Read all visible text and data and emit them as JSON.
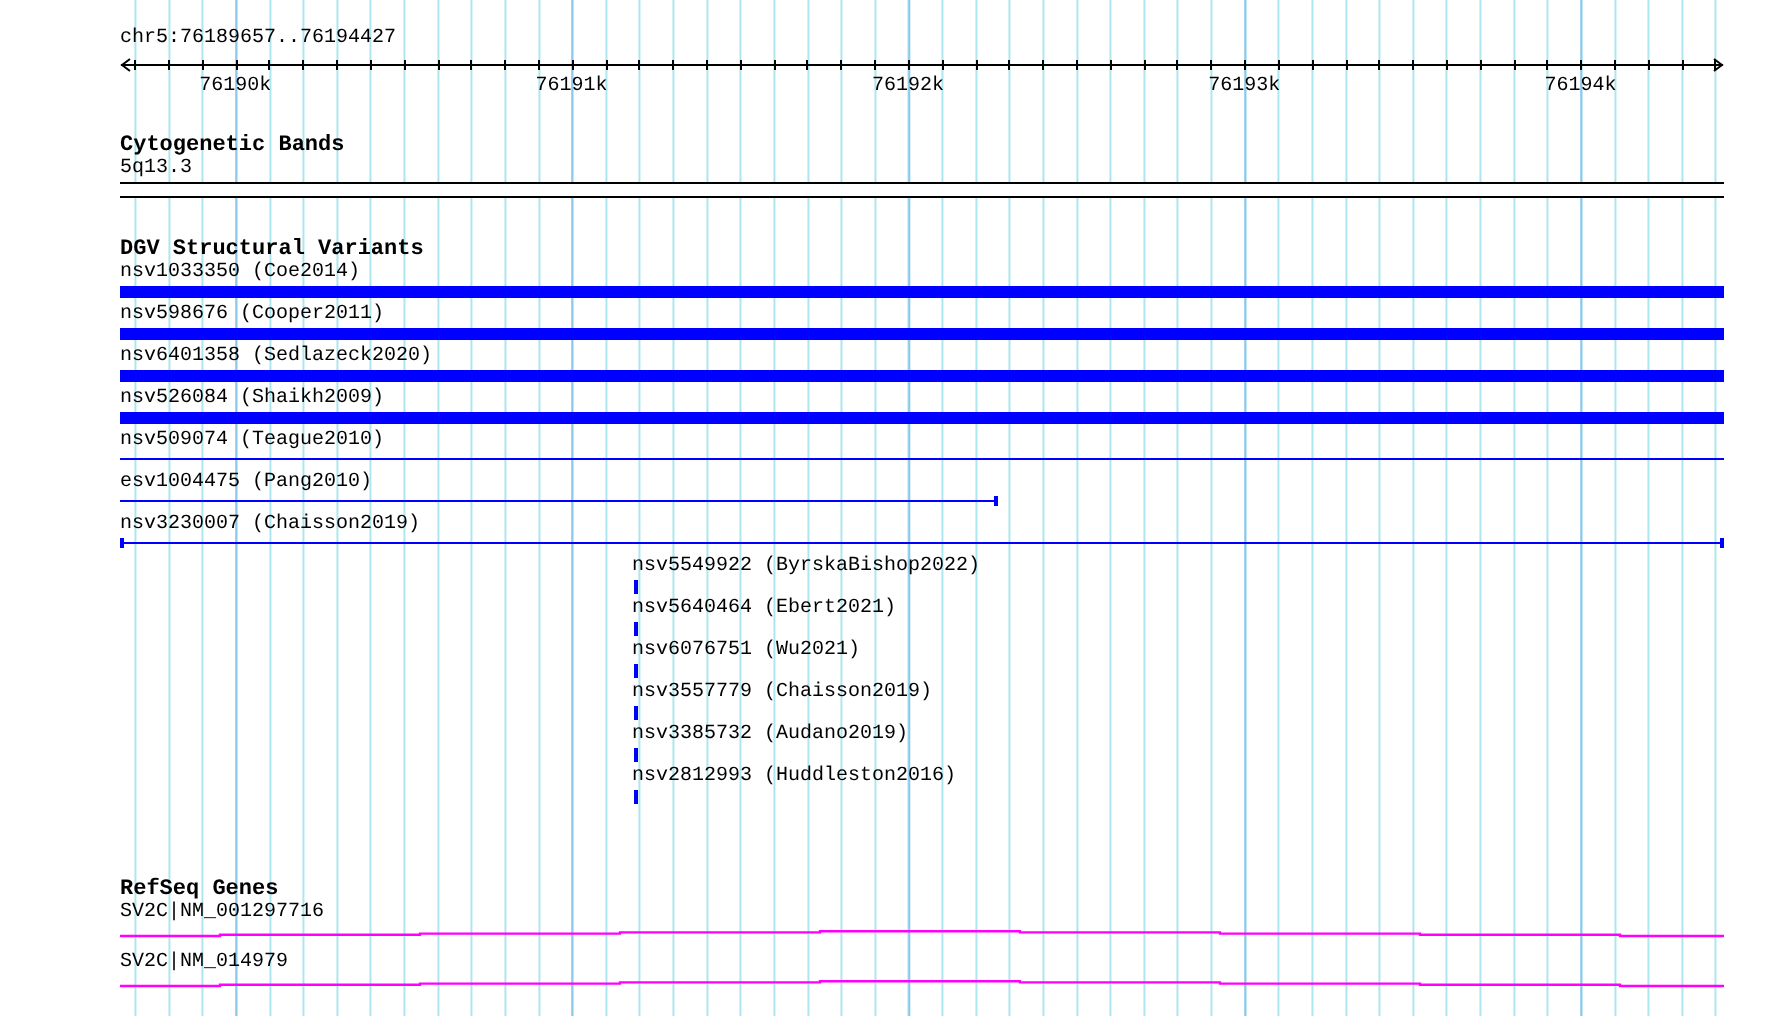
{
  "locus": "chr5:76189657..76194427",
  "axis": {
    "tick_labels": [
      "76190k",
      "76191k",
      "76192k",
      "76193k",
      "76194k"
    ]
  },
  "tracks": [
    {
      "kind": "bands",
      "title": "Cytogenetic Bands",
      "features": [
        {
          "label": "5q13.3"
        }
      ]
    },
    {
      "kind": "variants",
      "title": "DGV Structural Variants",
      "features": [
        {
          "label": "nsv1033350 (Coe2014)",
          "kind": "thick"
        },
        {
          "label": "nsv598676 (Cooper2011)",
          "kind": "thick"
        },
        {
          "label": "nsv6401358 (Sedlazeck2020)",
          "kind": "thick"
        },
        {
          "label": "nsv526084 (Shaikh2009)",
          "kind": "thick"
        },
        {
          "label": "nsv509074 (Teague2010)",
          "kind": "thin"
        },
        {
          "label": "esv1004475 (Pang2010)",
          "kind": "partial"
        },
        {
          "label": "nsv3230007 (Chaisson2019)",
          "kind": "capped"
        },
        {
          "label": "nsv5549922 (ByrskaBishop2022)",
          "kind": "point"
        },
        {
          "label": "nsv5640464 (Ebert2021)",
          "kind": "point"
        },
        {
          "label": "nsv6076751 (Wu2021)",
          "kind": "point"
        },
        {
          "label": "nsv3557779 (Chaisson2019)",
          "kind": "point"
        },
        {
          "label": "nsv3385732 (Audano2019)",
          "kind": "point"
        },
        {
          "label": "nsv2812993 (Huddleston2016)",
          "kind": "point"
        }
      ]
    },
    {
      "kind": "genes",
      "title": "RefSeq Genes",
      "features": [
        {
          "label": "SV2C|NM_001297716"
        },
        {
          "label": "SV2C|NM_014979"
        }
      ]
    }
  ]
}
